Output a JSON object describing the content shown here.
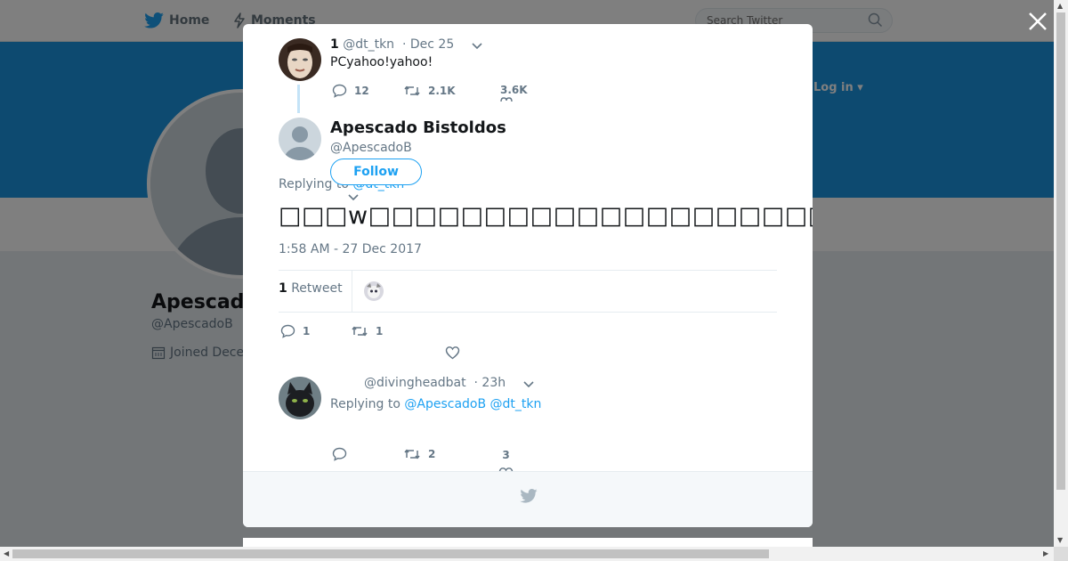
{
  "nav": {
    "home_label": "Home",
    "moments_label": "Moments",
    "login_label": "Log in ▾"
  },
  "search": {
    "placeholder": "Search Twitter"
  },
  "profile_bg": {
    "name": "Apescado",
    "handle": "@ApescadoB",
    "joined": "Joined Dece"
  },
  "thread_parent": {
    "display_name": "1",
    "handle": "@dt_tkn",
    "date": "· Dec 25",
    "text": "PCyahoo!yahoo!",
    "replies": "12",
    "retweets": "2.1K",
    "likes": "3.6K"
  },
  "main_tweet": {
    "name": "Apescado Bistoldos",
    "handle": "@ApescadoB",
    "follow_label": "Follow",
    "replying_prefix": "Replying to",
    "replying_to": "@dt_tkn",
    "text": "□□□w□□□□□□□□□□□□□□□□□□□□□□□□□□□□□□□□□□□□□□□□□□□□□□□□□",
    "timestamp": "1:58 AM - 27 Dec 2017",
    "retweet_count": "1",
    "retweet_label": "Retweet",
    "replies": "1",
    "retweets": "1"
  },
  "reply_tweet": {
    "handle": "@divingheadbat",
    "time": "· 23h",
    "replying_prefix": "Replying to",
    "replying_to": "@ApescadoB @dt_tkn",
    "retweets": "2",
    "likes": "3"
  },
  "colors": {
    "accent": "#1da1f2",
    "banner": "#1b95e0",
    "muted": "#657786"
  }
}
